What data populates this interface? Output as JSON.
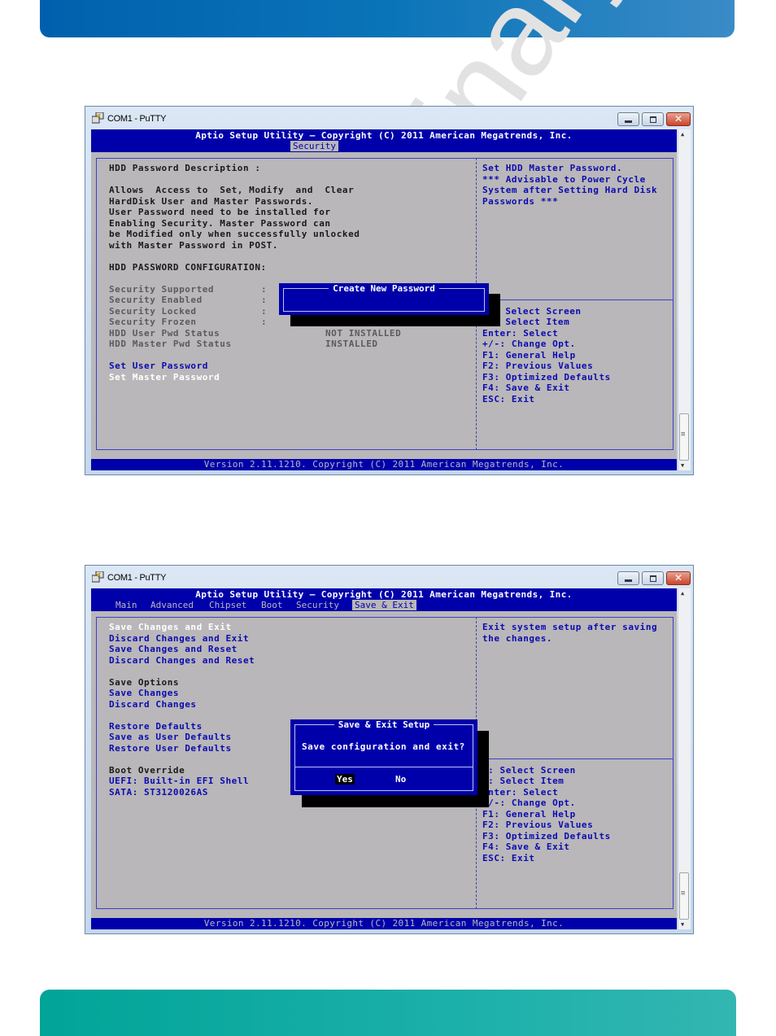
{
  "page": {
    "watermark": "Preliminary"
  },
  "window_top": {
    "title": "COM1 - PuTTY",
    "close_glyph": "✕",
    "header_title": "Aptio Setup Utility – Copyright (C) 2011 American Megatrends, Inc.",
    "active_tab": "Security",
    "footer": "Version 2.11.1210. Copyright (C) 2011 American Megatrends, Inc.",
    "left_panel": {
      "description_title": "HDD Password Description :",
      "description_lines": [
        "Allows  Access to  Set, Modify  and  Clear",
        "HardDisk User and Master Passwords.",
        "User Password need to be installed for",
        "Enabling Security. Master Password can",
        "be Modified only when successfully unlocked",
        "with Master Password in POST."
      ],
      "config_title": "HDD PASSWORD CONFIGURATION:",
      "status_rows": [
        {
          "label": "Security Supported",
          "sep": ":",
          "value": ""
        },
        {
          "label": "Security Enabled",
          "sep": ":",
          "value": ""
        },
        {
          "label": "Security Locked",
          "sep": ":",
          "value": ""
        },
        {
          "label": "Security Frozen",
          "sep": ":",
          "value": ""
        },
        {
          "label": "HDD User Pwd Status",
          "sep": "",
          "value": "NOT INSTALLED"
        },
        {
          "label": "HDD Master Pwd Status",
          "sep": "",
          "value": "INSTALLED"
        }
      ],
      "actions": [
        {
          "label": "Set User Password",
          "selected": false
        },
        {
          "label": "Set Master Password",
          "selected": true
        }
      ]
    },
    "help_text": [
      "Set HDD Master Password.",
      "*** Advisable to Power Cycle",
      "System after Setting Hard Disk",
      "Passwords ***"
    ],
    "key_help": [
      "  Select Screen",
      "  Select Item",
      "Enter: Select",
      "+/-: Change Opt.",
      "F1: General Help",
      "F2: Previous Values",
      "F3: Optimized Defaults",
      "F4: Save & Exit",
      "ESC: Exit"
    ],
    "dialog": {
      "title": "Create New Password",
      "input_value": ""
    }
  },
  "window_bottom": {
    "title": "COM1 - PuTTY",
    "close_glyph": "✕",
    "header_title": "Aptio Setup Utility – Copyright (C) 2011 American Megatrends, Inc.",
    "tabs": [
      {
        "label": "Main",
        "selected": false
      },
      {
        "label": "Advanced",
        "selected": false
      },
      {
        "label": "Chipset",
        "selected": false
      },
      {
        "label": "Boot",
        "selected": false
      },
      {
        "label": "Security",
        "selected": false
      },
      {
        "label": "Save & Exit",
        "selected": true
      }
    ],
    "footer": "Version 2.11.1210. Copyright (C) 2011 American Megatrends, Inc.",
    "menu_groups": [
      {
        "heading": "",
        "items": [
          {
            "label": "Save Changes and Exit",
            "selected": true
          },
          {
            "label": "Discard Changes and Exit",
            "selected": false
          },
          {
            "label": "Save Changes and Reset",
            "selected": false
          },
          {
            "label": "Discard Changes and Reset",
            "selected": false
          }
        ]
      },
      {
        "heading": "Save Options",
        "items": [
          {
            "label": "Save Changes",
            "selected": false
          },
          {
            "label": "Discard Changes",
            "selected": false
          }
        ]
      },
      {
        "heading": "",
        "items": [
          {
            "label": "Restore Defaults",
            "selected": false
          },
          {
            "label": "Save as User Defaults",
            "selected": false
          },
          {
            "label": "Restore User Defaults",
            "selected": false
          }
        ]
      },
      {
        "heading": "Boot Override",
        "items": [
          {
            "label": "UEFI: Built-in EFI Shell",
            "selected": false
          },
          {
            "label": "SATA: ST3120026AS",
            "selected": false
          }
        ]
      }
    ],
    "help_text": [
      "Exit system setup after saving",
      "the changes."
    ],
    "key_help": [
      "←: Select Screen",
      "↓: Select Item",
      "Enter: Select",
      "+/-: Change Opt.",
      "F1: General Help",
      "F2: Previous Values",
      "F3: Optimized Defaults",
      "F4: Save & Exit",
      "ESC: Exit"
    ],
    "dialog": {
      "title": "Save & Exit Setup",
      "message": "Save configuration and exit?",
      "yes_label": "Yes",
      "no_label": "No",
      "selected": "Yes"
    }
  }
}
